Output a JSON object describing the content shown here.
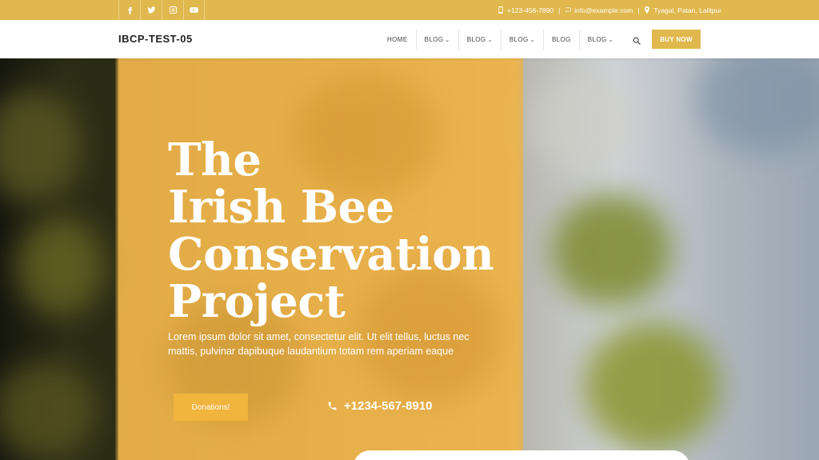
{
  "topbar": {
    "social_icons": [
      "facebook-icon",
      "twitter-icon",
      "instagram-icon",
      "youtube-icon"
    ],
    "phone": "+123-456-7890",
    "email": "info@example.com",
    "location": "Tyagal, Patan, Lalitpur",
    "separator": "|"
  },
  "navbar": {
    "brand": "IBCP-TEST-05",
    "menu": [
      {
        "label": "HOME",
        "caret": ""
      },
      {
        "label": "BLOG",
        "caret": "⌄"
      },
      {
        "label": "BLOG",
        "caret": "⌄"
      },
      {
        "label": "BLOG",
        "caret": "⌄"
      },
      {
        "label": "BLOG",
        "caret": ""
      },
      {
        "label": "BLOG",
        "caret": "⌄"
      }
    ],
    "buy_label": "BUY NOW"
  },
  "hero": {
    "title_lines": [
      "The",
      "Irish Bee",
      "Conservation",
      "Project"
    ],
    "description": "Lorem ipsum dolor sit amet, consectetur elit. Ut elit tellus, luctus nec mattis, pulvinar dapibuque laudantium totam rem aperiam eaque",
    "donate_label": "Donations!",
    "phone": "+1234-567-8910"
  },
  "colors": {
    "accent": "#e0b84d",
    "panel": "#ecb24a"
  }
}
